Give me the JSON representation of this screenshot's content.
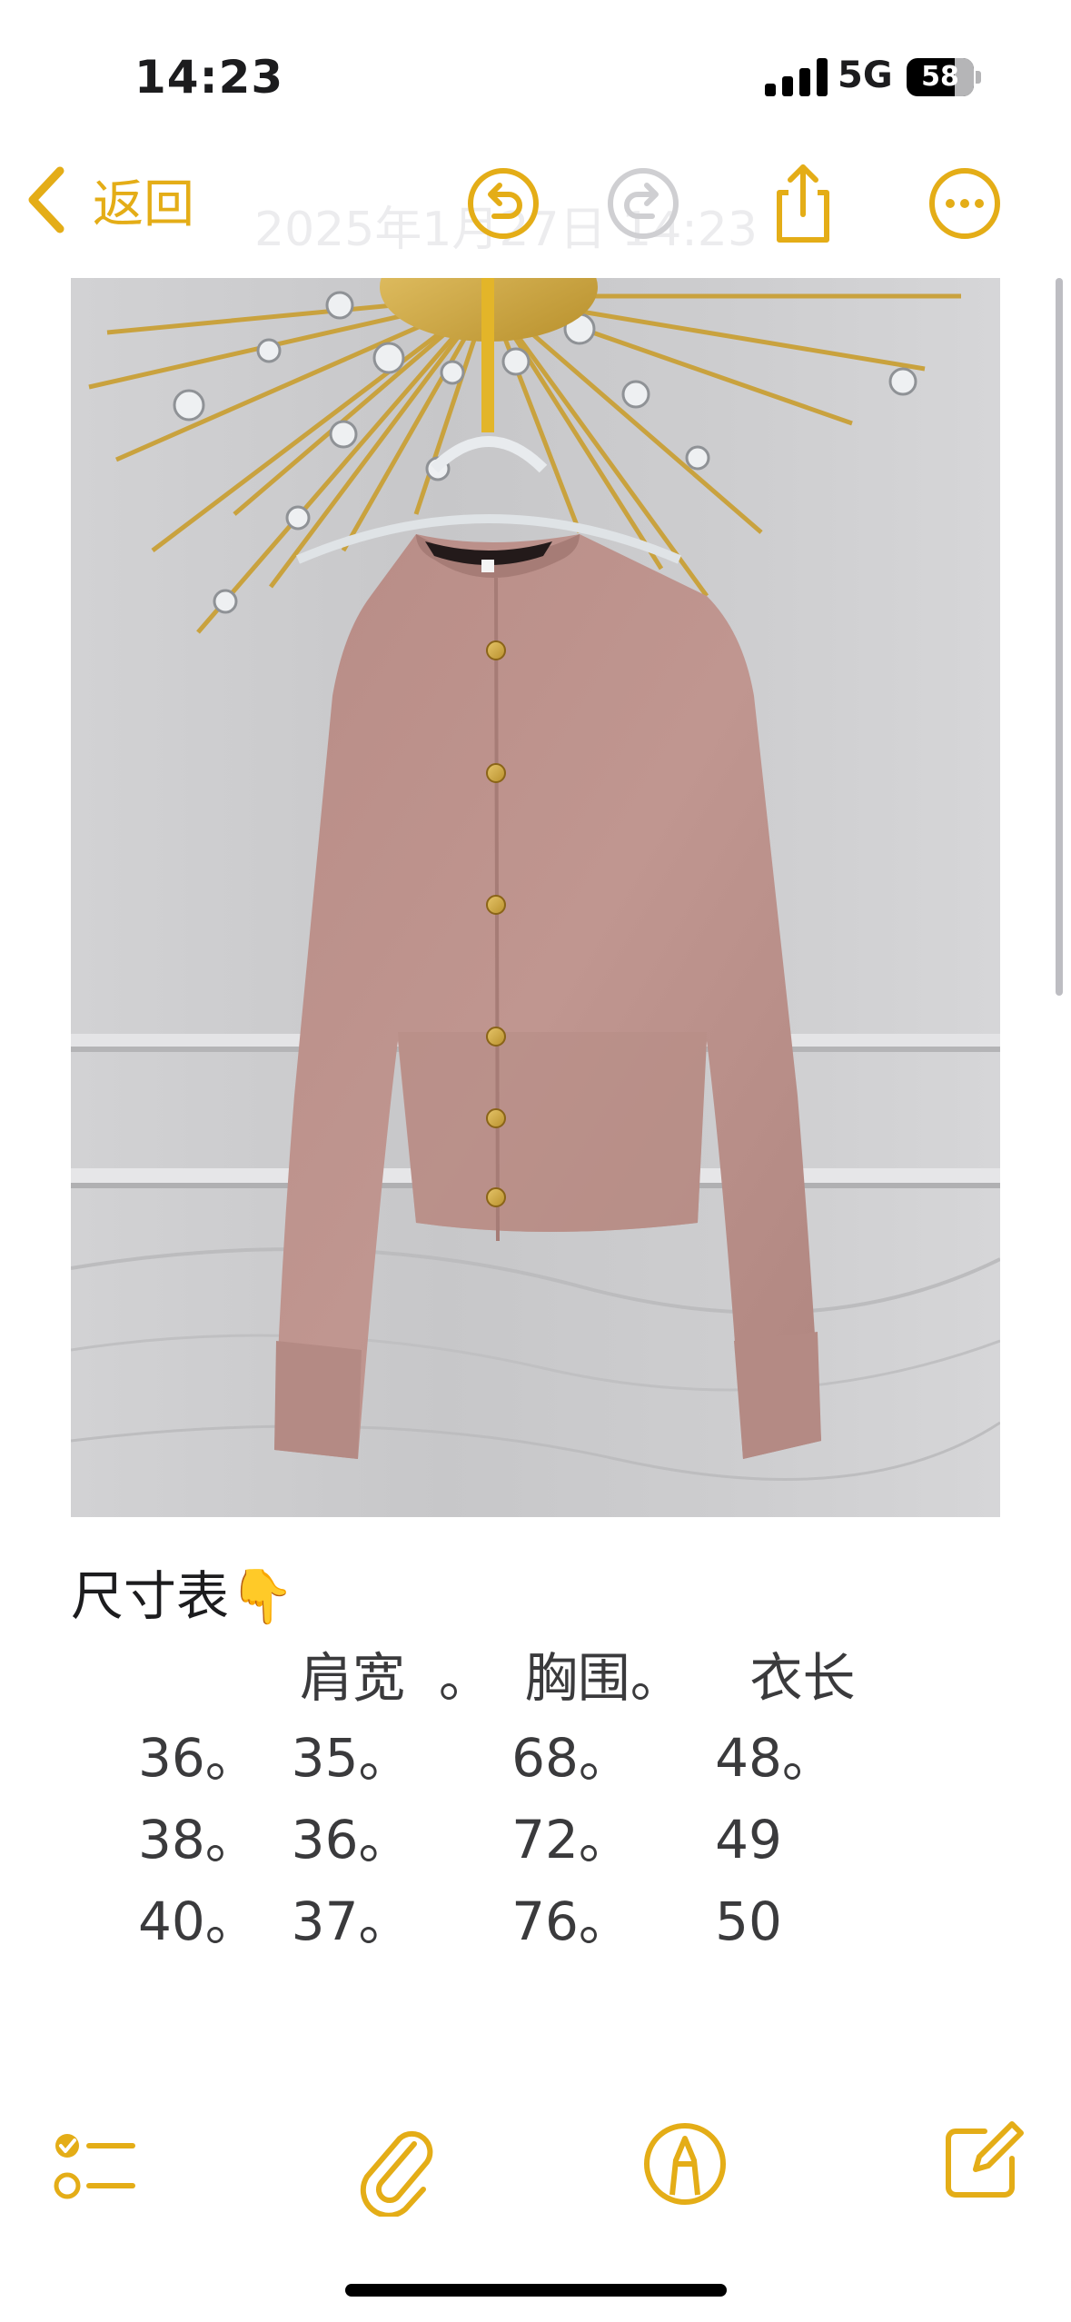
{
  "status_bar": {
    "time": "14:23",
    "network": "5G",
    "battery_level": "58"
  },
  "nav": {
    "back_label": "返回",
    "date_faded": "2025年1月27日 14:23"
  },
  "note": {
    "heading": "尺寸表👇",
    "table_header": "肩宽  。  胸围。    衣长",
    "rows": [
      "36。  35。      68。     48。",
      "38。  36。      72。     49",
      "40。  37。      76。     50"
    ]
  },
  "colors": {
    "accent": "#e4ad17",
    "text": "#3a3a3c"
  }
}
